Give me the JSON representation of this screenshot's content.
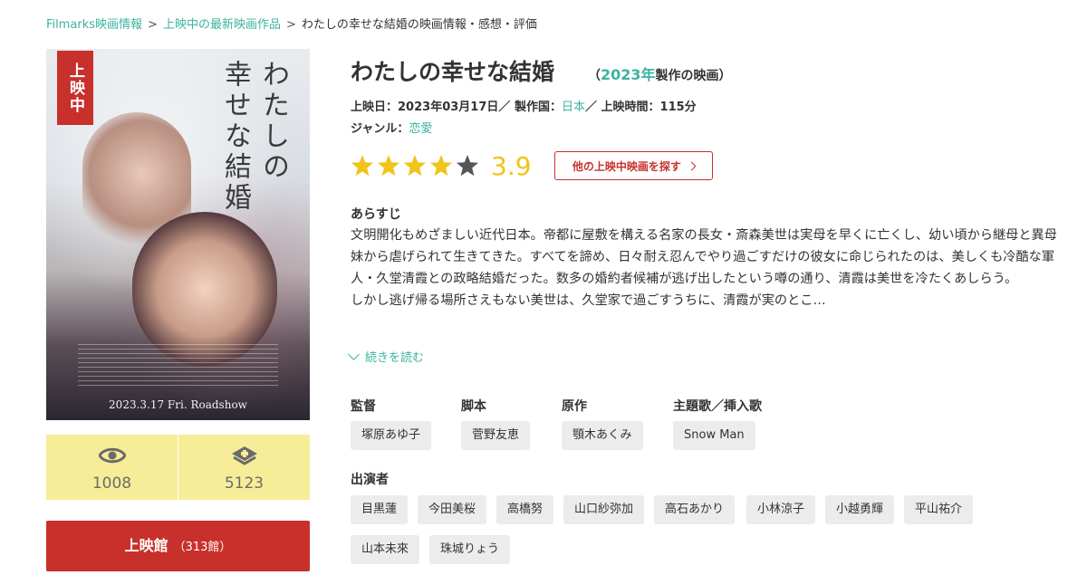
{
  "breadcrumb": {
    "home": "Filmarks映画情報",
    "section": "上映中の最新映画作品",
    "current": "わたしの幸せな結婚の映画情報・感想・評価",
    "separator": ">"
  },
  "poster": {
    "badge": "上映中",
    "title_text": "わたしの\n幸せな結婚",
    "date_text": "2023.3.17 Fri. Roadshow"
  },
  "stats": {
    "watched_count": "1008",
    "clip_count": "5123",
    "watched_icon": "eye-icon",
    "clip_icon": "bookmark-plus-icon"
  },
  "theater_button": {
    "label": "上映館",
    "count": "（313館）"
  },
  "movie": {
    "title": "わたしの幸せな結婚",
    "year_prefix": "（",
    "year": "2023年",
    "year_suffix": "製作の映画）",
    "release_label": "上映日：",
    "release_date": "2023年03月17日",
    "sep1": "／",
    "country_label": "製作国：",
    "country": "日本",
    "sep2": "／",
    "runtime_label": "上映時間：",
    "runtime": "115分",
    "genre_label": "ジャンル：",
    "genre": "恋愛"
  },
  "rating": {
    "score": "3.9",
    "value": 3.9,
    "max": 5,
    "star_color": "#f0c419",
    "empty_star_color": "#555555"
  },
  "other_movies_button": "他の上映中映画を探す",
  "synopsis": {
    "heading": "あらすじ",
    "para1": "文明開化もめざましい近代日本。帝都に屋敷を構える名家の長女・斎森美世は実母を早くに亡くし、幼い頃から継母と異母妹から虐げられて生きてきた。すべてを諦め、日々耐え忍んでやり過ごすだけの彼女に命じられたのは、美しくも冷酷な軍人・久堂清霞との政略結婚だった。数多の婚約者候補が逃げ出したという噂の通り、清霞は美世を冷たくあしらう。",
    "para2": "しかし逃げ帰る場所さえもない美世は、久堂家で過ごすうちに、清霞が実のとこ…",
    "read_more": "続きを読む"
  },
  "credits": {
    "director_label": "監督",
    "director": "塚原あゆ子",
    "screenplay_label": "脚本",
    "screenplay": "菅野友恵",
    "original_label": "原作",
    "original": "顎木あくみ",
    "theme_label": "主題歌／挿入歌",
    "theme": "Snow Man"
  },
  "cast": {
    "label": "出演者",
    "members": [
      "目黒蓮",
      "今田美桜",
      "高橋努",
      "山口紗弥加",
      "高石あかり",
      "小林涼子",
      "小越勇輝",
      "平山祐介",
      "山本未來",
      "珠城りょう"
    ]
  },
  "colors": {
    "accent_green": "#3cb39f",
    "brand_red": "#c8302b",
    "stat_yellow": "#f7ed98"
  }
}
